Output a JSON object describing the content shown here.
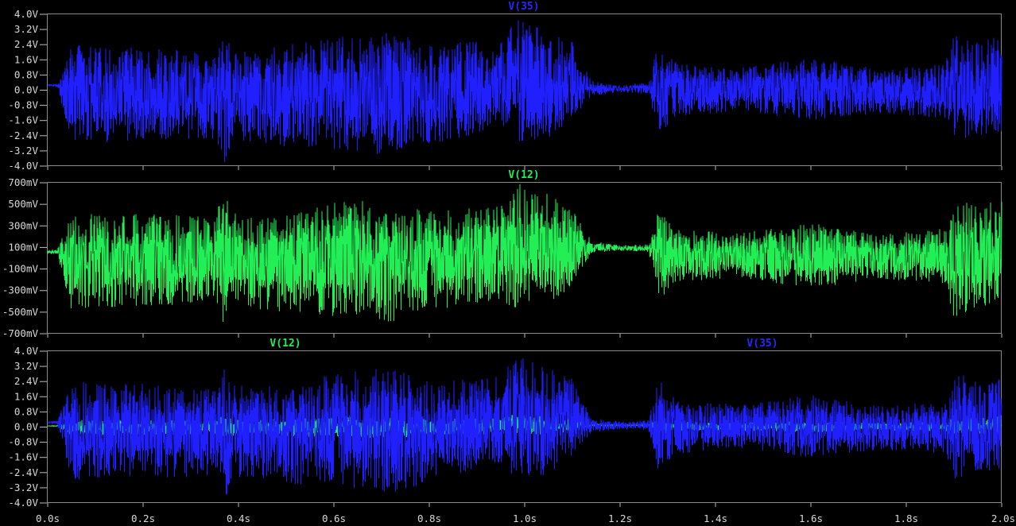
{
  "chart_data": [
    {
      "type": "line",
      "title": "V(35)",
      "series": [
        {
          "name": "V(35)",
          "color": "#2020ff",
          "envelope": "v35"
        }
      ],
      "ylim": [
        -4.0,
        4.0
      ],
      "yticks": [
        "4.0V",
        "3.2V",
        "2.4V",
        "1.6V",
        "0.8V",
        "0.0V",
        "-0.8V",
        "-1.6V",
        "-2.4V",
        "-3.2V",
        "-4.0V"
      ],
      "xlim": [
        0.0,
        2.0
      ],
      "grid": false
    },
    {
      "type": "line",
      "title": "V(12)",
      "series": [
        {
          "name": "V(12)",
          "color": "#22ee55",
          "envelope": "v12"
        }
      ],
      "ylim": [
        -700,
        700
      ],
      "yticks": [
        "700mV",
        "500mV",
        "300mV",
        "100mV",
        "-100mV",
        "-300mV",
        "-500mV",
        "-700mV"
      ],
      "xlim": [
        0.0,
        2.0
      ],
      "grid": false
    },
    {
      "type": "line",
      "title": "",
      "series": [
        {
          "name": "V(12)",
          "color": "#22ee55",
          "envelope": "v12"
        },
        {
          "name": "V(35)",
          "color": "#2020ff",
          "envelope": "v35"
        }
      ],
      "legend": [
        "V(12)",
        "V(35)"
      ],
      "ylim": [
        -4.0,
        4.0
      ],
      "yticks": [
        "4.0V",
        "3.2V",
        "2.4V",
        "1.6V",
        "0.8V",
        "0.0V",
        "-0.8V",
        "-1.6V",
        "-2.4V",
        "-3.2V",
        "-4.0V"
      ],
      "xlim": [
        0.0,
        2.0
      ],
      "xticks": [
        "0.0s",
        "0.2s",
        "0.4s",
        "0.6s",
        "0.8s",
        "1.0s",
        "1.2s",
        "1.4s",
        "1.6s",
        "1.8s",
        "2.0s"
      ],
      "grid": false
    }
  ],
  "envelopes": {
    "v35": {
      "t": [
        0.0,
        0.02,
        0.05,
        0.35,
        0.37,
        0.39,
        0.43,
        0.65,
        0.72,
        0.8,
        0.95,
        0.98,
        1.05,
        1.1,
        1.14,
        1.2,
        1.26,
        1.28,
        1.32,
        1.45,
        1.6,
        1.75,
        1.88,
        1.9,
        1.95,
        2.0
      ],
      "max": [
        0.3,
        0.3,
        2.4,
        2.2,
        3.2,
        2.3,
        2.1,
        3.0,
        3.1,
        2.4,
        2.7,
        3.8,
        3.2,
        2.6,
        0.5,
        0.3,
        0.4,
        2.6,
        1.4,
        1.2,
        1.7,
        1.1,
        1.4,
        3.0,
        2.5,
        3.0
      ],
      "min": [
        0.2,
        0.2,
        -2.8,
        -2.6,
        -4.0,
        -2.6,
        -2.8,
        -3.3,
        -3.5,
        -2.9,
        -2.0,
        -2.8,
        -2.5,
        -1.5,
        -0.3,
        -0.1,
        -0.2,
        -2.3,
        -1.4,
        -1.1,
        -1.6,
        -1.2,
        -1.5,
        -2.8,
        -2.5,
        -2.2
      ]
    },
    "v12": {
      "t": [
        0.0,
        0.02,
        0.05,
        0.35,
        0.37,
        0.39,
        0.43,
        0.65,
        0.72,
        0.8,
        0.95,
        0.98,
        1.05,
        1.1,
        1.14,
        1.2,
        1.26,
        1.28,
        1.32,
        1.45,
        1.6,
        1.75,
        1.88,
        1.9,
        1.95,
        2.0
      ],
      "max": [
        80,
        80,
        420,
        400,
        620,
        420,
        390,
        560,
        500,
        440,
        480,
        710,
        600,
        460,
        160,
        120,
        130,
        450,
        280,
        240,
        330,
        220,
        280,
        580,
        480,
        580
      ],
      "min": [
        40,
        40,
        -480,
        -420,
        -650,
        -450,
        -470,
        -560,
        -590,
        -500,
        -380,
        -480,
        -420,
        -300,
        50,
        70,
        60,
        -400,
        -220,
        -180,
        -280,
        -190,
        -240,
        -560,
        -460,
        -420
      ]
    }
  }
}
